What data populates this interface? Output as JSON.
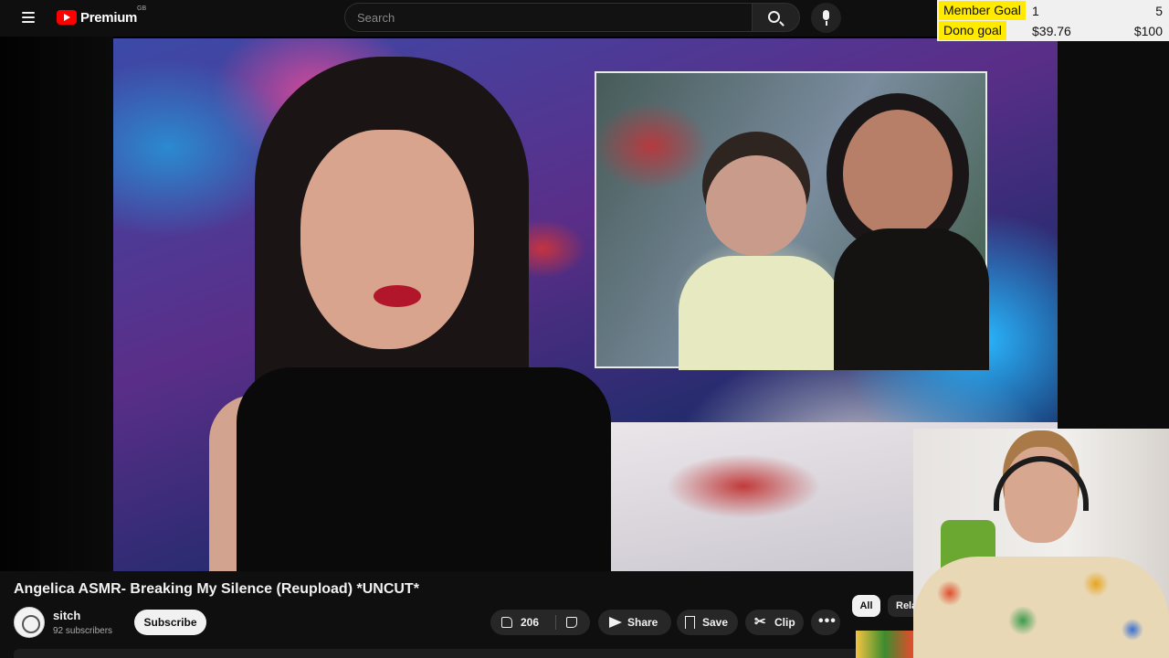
{
  "header": {
    "logo_text": "Premium",
    "region": "GB",
    "search_placeholder": "Search"
  },
  "goals": {
    "member": {
      "label": "Member Goal",
      "current": "1",
      "target": "5"
    },
    "dono": {
      "label": "Dono goal",
      "current": "$39.76",
      "target": "$100"
    }
  },
  "video": {
    "title": "Angelica ASMR- Breaking My Silence (Reupload) *UNCUT*"
  },
  "channel": {
    "name": "sitch",
    "subscribers": "92 subscribers",
    "subscribe_label": "Subscribe"
  },
  "actions": {
    "like_count": "206",
    "share_label": "Share",
    "save_label": "Save",
    "clip_label": "Clip"
  },
  "chips": {
    "all": "All",
    "related": "Related"
  },
  "icons": [
    "menu-icon",
    "youtube-logo-icon",
    "search-icon",
    "microphone-icon",
    "like-icon",
    "dislike-icon",
    "share-icon",
    "save-icon",
    "clip-icon",
    "more-icon"
  ],
  "colors": {
    "brand_red": "#ff0000",
    "goal_highlight": "#ffea00",
    "background": "#0f0f0f"
  }
}
